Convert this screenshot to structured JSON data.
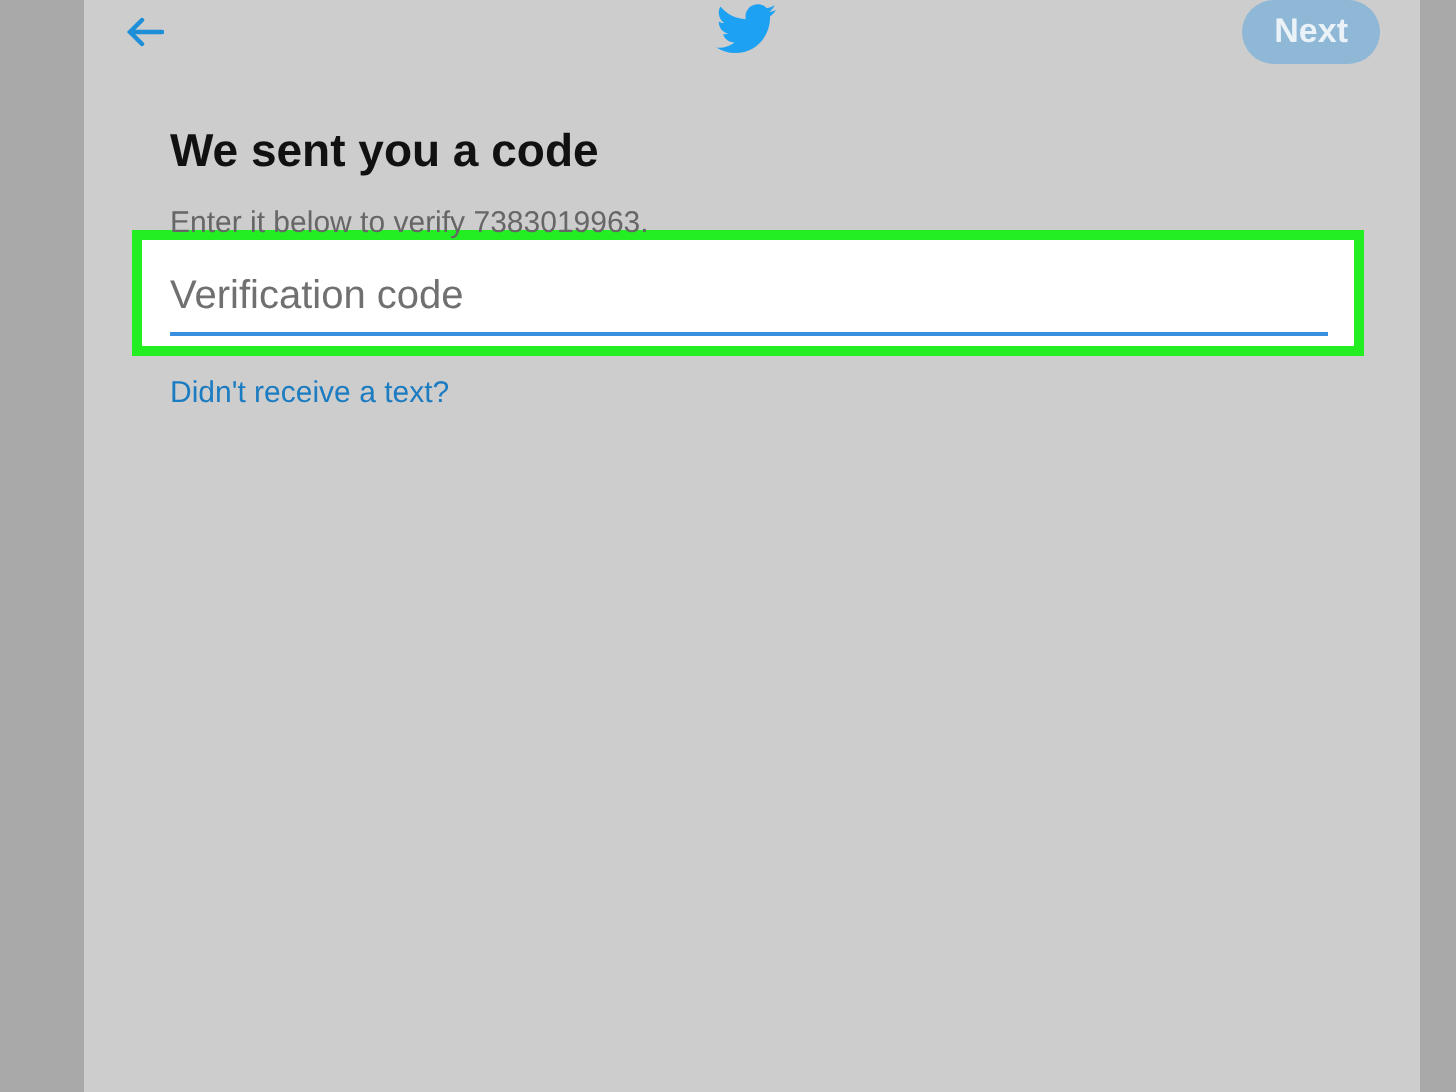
{
  "header": {
    "next_button": {
      "label": "Next",
      "disabled": true
    }
  },
  "title": "We sent you a code",
  "subtitle": "Enter it below to verify 7383019963.",
  "code_field": {
    "placeholder": "Verification code",
    "highlighted": true
  },
  "resend_link": "Didn't receive a text?"
}
